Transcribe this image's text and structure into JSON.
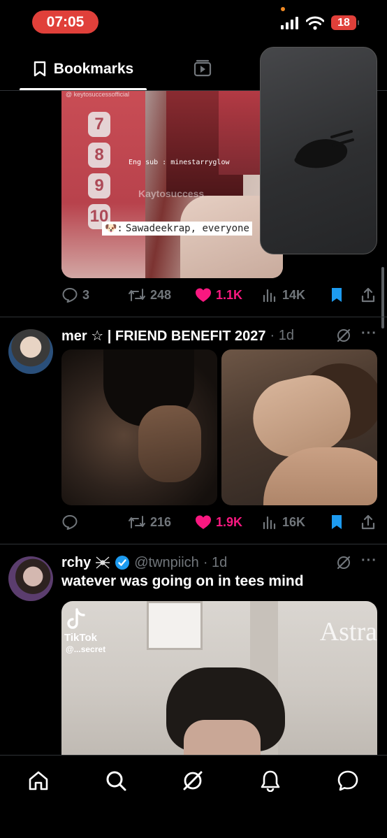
{
  "status_bar": {
    "time": "07:05",
    "battery": "18"
  },
  "tabs": {
    "bookmarks_label": "Bookmarks"
  },
  "tweet1": {
    "media": {
      "watermark": "@ keytosuccessofficial",
      "numbers": [
        "7",
        "8",
        "9",
        "10"
      ],
      "eng_sub": "Eng sub : minestarryglow",
      "brand": "Kaytosuccess",
      "caption": "Sawadeekrap, everyone"
    },
    "actions": {
      "replies": "3",
      "reposts": "248",
      "likes": "1.1K",
      "views": "14K"
    }
  },
  "tweet2": {
    "name": "mer ☆ | FRIEND BENEFIT 2027",
    "time": "· 1d",
    "actions": {
      "reposts": "216",
      "likes": "1.9K",
      "views": "16K"
    }
  },
  "tweet3": {
    "name": "rchy",
    "handle": "@twnpiich",
    "time": "· 1d",
    "text": "watever was going on in tees mind",
    "media": {
      "tiktok_label": "TikTok",
      "tiktok_user": "@...secret",
      "brand": "Astra"
    }
  },
  "colors": {
    "like": "#f91880",
    "bookmark": "#1d9bf0",
    "verified": "#1d9bf0",
    "status_time_bg": "#e0403a"
  },
  "icons": [
    "bookmark-tab-icon",
    "video-tab-icon",
    "reply-icon",
    "repost-icon",
    "like-icon",
    "views-icon",
    "bookmark-icon",
    "share-icon",
    "grok-icon",
    "more-icon",
    "verified-icon",
    "home-icon",
    "search-icon",
    "notifications-icon",
    "messages-icon"
  ]
}
